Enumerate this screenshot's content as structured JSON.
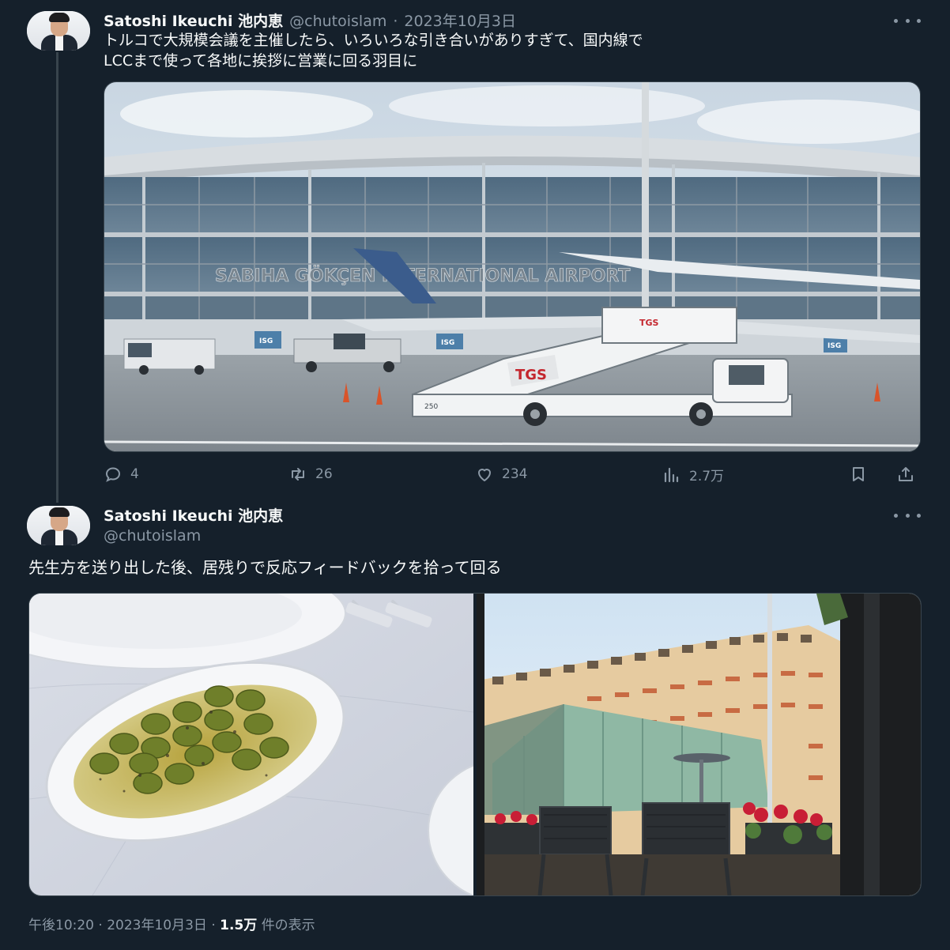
{
  "tweet1": {
    "name": "Satoshi Ikeuchi 池内恵",
    "handle": "@chutoislam",
    "separator": "·",
    "date": "2023年10月3日",
    "text_line1": "トルコで大規模会議を主催したら、いろいろな引き合いがありすぎて、国内線で",
    "text_line2": "LCCまで使って各地に挨拶に営業に回る羽目に",
    "image_text": {
      "terminal_sign": "SABIHA GÖKÇEN INTERNATIONAL AIRPORT",
      "stairs_logo": "TGS",
      "stairs_number": "250",
      "isg_label": "ISG"
    },
    "actions": {
      "replies": "4",
      "retweets": "26",
      "likes": "234",
      "views": "2.7万"
    }
  },
  "tweet2": {
    "name": "Satoshi Ikeuchi 池内恵",
    "handle": "@chutoislam",
    "text": "先生方を送り出した後、居残りで反応フィードバックを拾って回る",
    "footer": {
      "time": "午後10:20",
      "separator": "·",
      "date": "2023年10月3日",
      "views_count": "1.5万",
      "views_label": "件の表示"
    }
  },
  "icons": {
    "more": "more-icon",
    "reply": "reply-icon",
    "retweet": "retweet-icon",
    "like": "heart-icon",
    "views": "views-icon",
    "bookmark": "bookmark-icon",
    "share": "share-icon"
  },
  "colors": {
    "background": "#15202b",
    "text": "#f7f9f9",
    "muted": "#8b98a5",
    "border": "#38444d"
  }
}
